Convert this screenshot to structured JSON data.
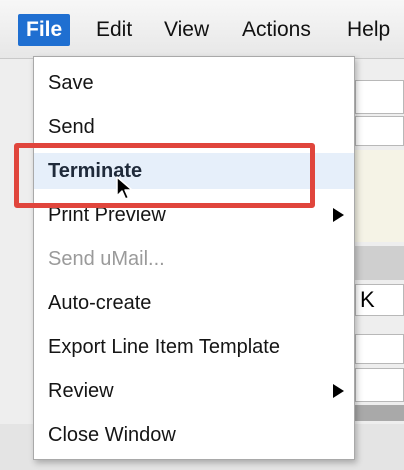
{
  "menubar": {
    "items": [
      {
        "label": "File"
      },
      {
        "label": "Edit"
      },
      {
        "label": "View"
      },
      {
        "label": "Actions"
      },
      {
        "label": "Help"
      }
    ],
    "active": "File"
  },
  "file_menu": {
    "items": [
      {
        "label": "Save"
      },
      {
        "label": "Send"
      },
      {
        "label": "Terminate"
      },
      {
        "label": "Print Preview"
      },
      {
        "label": "Send uMail..."
      },
      {
        "label": "Auto-create"
      },
      {
        "label": "Export Line Item Template"
      },
      {
        "label": "Review"
      },
      {
        "label": "Close Window"
      }
    ],
    "hovered": "Terminate",
    "disabled": [
      "Send uMail..."
    ],
    "with_submenu": [
      "Print Preview",
      "Review"
    ]
  },
  "background": {
    "field_value": "K"
  },
  "colors": {
    "menubar_active": "#1f6fd1",
    "highlight_border": "#e0453c",
    "hover_bg": "#e6effa"
  }
}
